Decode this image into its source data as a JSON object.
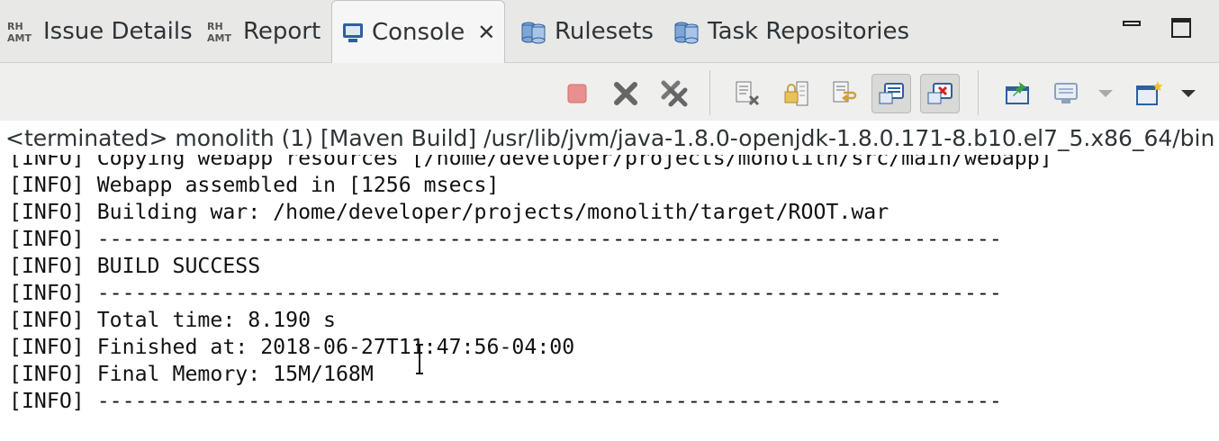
{
  "tabs": [
    {
      "label": "Issue Details",
      "icon": "rh-amt-icon"
    },
    {
      "label": "Report",
      "icon": "rh-amt-icon"
    },
    {
      "label": "Console",
      "icon": "console-icon",
      "active": true
    },
    {
      "label": "Rulesets",
      "icon": "ruleset-icon"
    },
    {
      "label": "Task Repositories",
      "icon": "task-repo-icon"
    }
  ],
  "toolbar": {
    "buttons": [
      "terminate",
      "remove-launch",
      "remove-all-terminated",
      "clear-console",
      "scroll-lock",
      "word-wrap",
      "show-on-stdout",
      "show-on-stderr",
      "pin-console",
      "display-selected-console",
      "open-console"
    ]
  },
  "process_label": "<terminated> monolith (1) [Maven Build] /usr/lib/jvm/java-1.8.0-openjdk-1.8.0.171-8.b10.el7_5.x86_64/bin",
  "console": {
    "lines": [
      "[INFO] Copying webapp resources [/home/developer/projects/monolith/src/main/webapp]",
      "[INFO] Webapp assembled in [1256 msecs]",
      "[INFO] Building war: /home/developer/projects/monolith/target/ROOT.war",
      "[INFO] ------------------------------------------------------------------------",
      "[INFO] BUILD SUCCESS",
      "[INFO] ------------------------------------------------------------------------",
      "[INFO] Total time: 8.190 s",
      "[INFO] Finished at: 2018-06-27T11:47:56-04:00",
      "[INFO] Final Memory: 15M/168M",
      "[INFO] ------------------------------------------------------------------------"
    ]
  },
  "colors": {
    "terminate": "#e06060",
    "accent": "#3a6ea5"
  }
}
